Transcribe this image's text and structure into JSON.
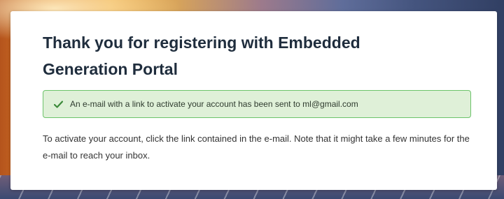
{
  "page": {
    "title": "Thank you for registering with Embedded Generation Portal",
    "alert": {
      "icon": "check-icon",
      "message": "An e-mail with a link to activate your account has been sent to ml@gmail.com",
      "color": "#dff0d8",
      "border_color": "#6cc36a"
    },
    "body_text": "To activate your account, click the link contained in the e-mail. Note that it might take a few minutes for the e-mail to reach your inbox."
  }
}
